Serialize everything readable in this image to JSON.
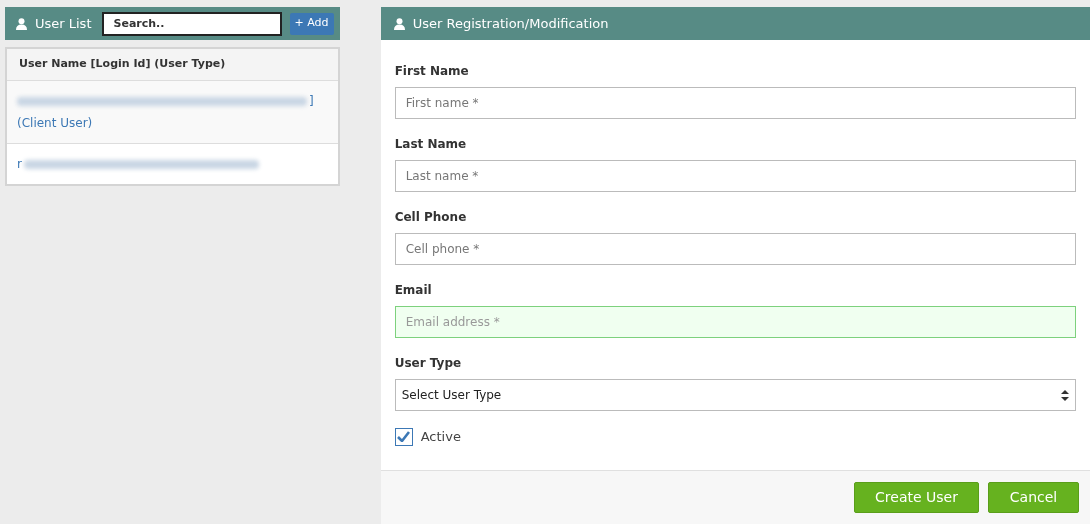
{
  "user_list": {
    "title": "User List",
    "search": {
      "placeholder": "Search.."
    },
    "add_button": "+ Add",
    "column": "User Name [Login Id] (User Type)",
    "rows": [
      {
        "visible_text": "]",
        "second_line": "(Client User)",
        "selected": false
      },
      {
        "visible_text": "r",
        "selected": false
      }
    ]
  },
  "form": {
    "title": "User Registration/Modification",
    "fields": [
      {
        "kind": "text",
        "label": "First Name",
        "placeholder": "First name *",
        "valid": false
      },
      {
        "kind": "text",
        "label": "Last Name",
        "placeholder": "Last name *",
        "valid": false
      },
      {
        "kind": "text",
        "label": "Cell Phone",
        "placeholder": "Cell phone *",
        "valid": false
      },
      {
        "kind": "text",
        "label": "Email",
        "placeholder": "Email address *",
        "valid": true
      },
      {
        "kind": "select",
        "label": "User Type",
        "value": "Select User Type"
      }
    ],
    "active": {
      "label": "Active",
      "checked": true
    },
    "buttons": [
      "Create User",
      "Cancel"
    ]
  }
}
